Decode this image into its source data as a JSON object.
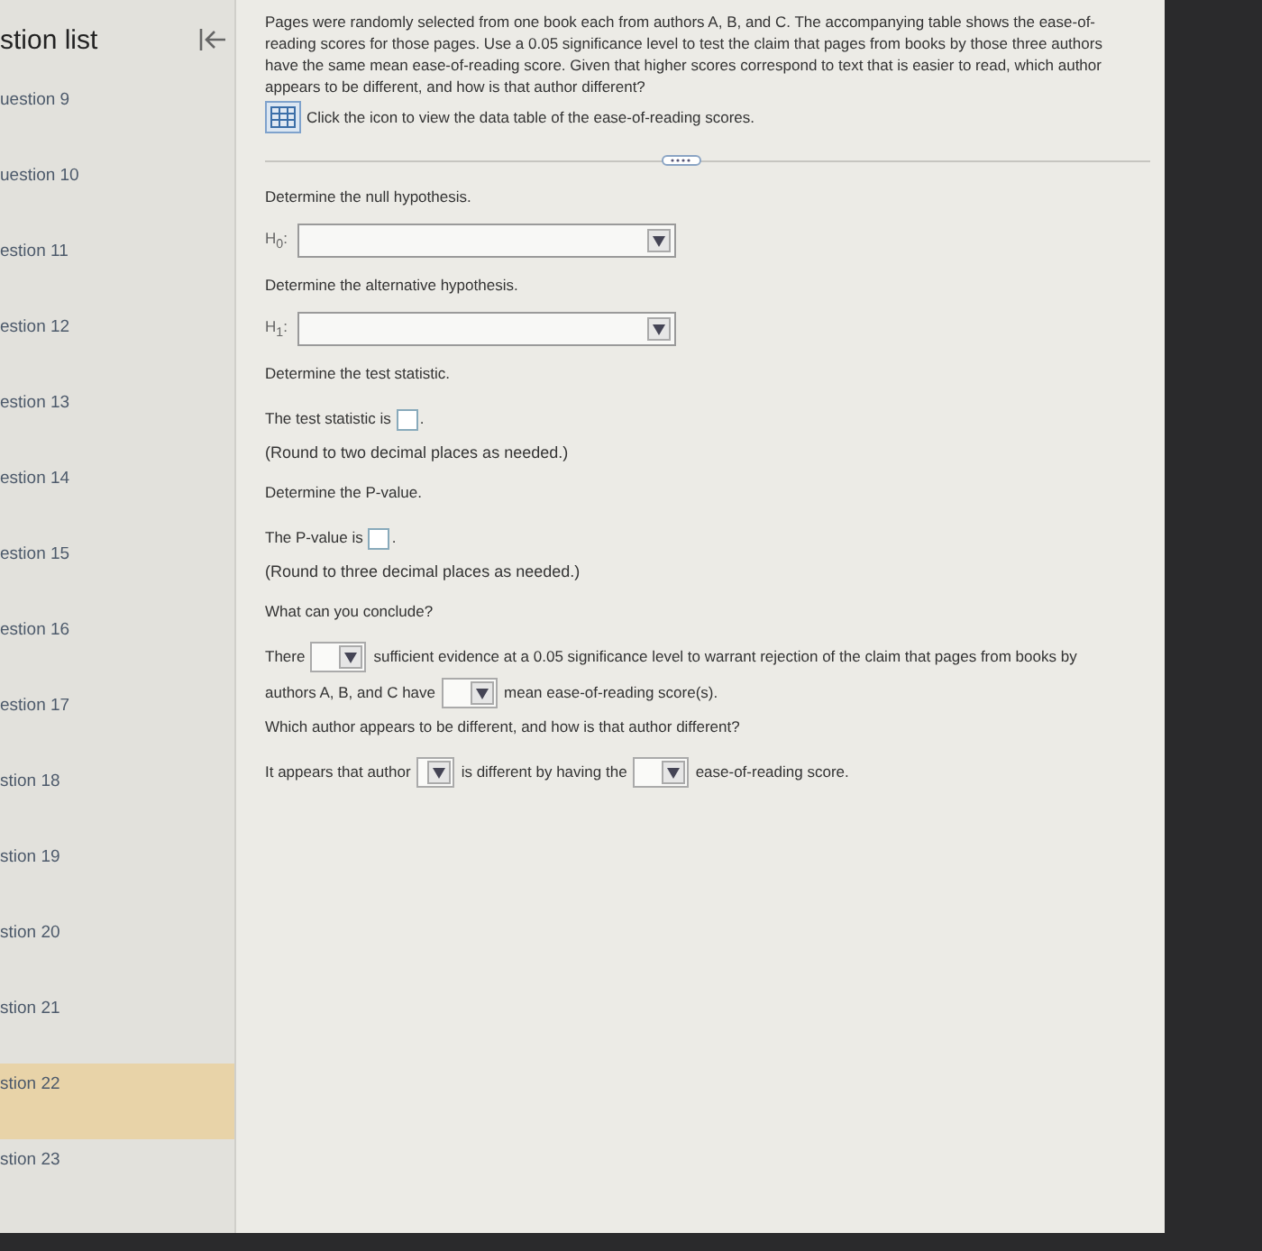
{
  "sidebar": {
    "title": "stion list",
    "items": [
      {
        "label": "uestion 9",
        "selected": false
      },
      {
        "label": "uestion 10",
        "selected": false
      },
      {
        "label": "estion 11",
        "selected": false
      },
      {
        "label": "estion 12",
        "selected": false
      },
      {
        "label": "estion 13",
        "selected": false
      },
      {
        "label": "estion 14",
        "selected": false
      },
      {
        "label": "estion 15",
        "selected": false
      },
      {
        "label": "estion 16",
        "selected": false
      },
      {
        "label": "estion 17",
        "selected": false
      },
      {
        "label": "stion 18",
        "selected": false
      },
      {
        "label": "stion 19",
        "selected": false
      },
      {
        "label": "stion 20",
        "selected": false
      },
      {
        "label": "stion 21",
        "selected": false
      },
      {
        "label": "stion 22",
        "selected": true
      },
      {
        "label": "stion 23",
        "selected": false
      }
    ]
  },
  "question": {
    "text": "Pages were randomly selected from one book each from authors A, B, and C. The accompanying table shows the ease-of-reading scores for those pages. Use a 0.05 significance level to test the claim that pages from books by those three authors have the same mean ease-of-reading score. Given that higher scores correspond to text that is easier to read, which author appears to be different, and how is that author different?",
    "table_link": "Click the icon to view the data table of the ease-of-reading scores."
  },
  "parts": [
    {
      "kind": "prompt",
      "text": "Determine the null hypothesis."
    },
    {
      "kind": "hypothesis",
      "label": "H$_{0}$:"
    },
    {
      "kind": "prompt",
      "text": "Determine the alternative hypothesis."
    },
    {
      "kind": "hypothesis",
      "label": "H$_{1}$:"
    },
    {
      "kind": "prompt",
      "text": "Determine the test statistic."
    },
    {
      "kind": "answer",
      "segments": [
        {
          "kind": "text",
          "text": "The test statistic is"
        },
        {
          "kind": "input"
        },
        {
          "kind": "text",
          "text": "."
        }
      ]
    },
    {
      "kind": "note",
      "text": "(Round to two decimal places as needed.)"
    },
    {
      "kind": "prompt",
      "text": "Determine the P-value."
    },
    {
      "kind": "answer",
      "segments": [
        {
          "kind": "text",
          "text": "The P-value is"
        },
        {
          "kind": "input"
        },
        {
          "kind": "text",
          "text": "."
        }
      ]
    },
    {
      "kind": "note",
      "text": "(Round to three decimal places as needed.)"
    },
    {
      "kind": "prompt",
      "text": "What can you conclude?"
    },
    {
      "kind": "answer",
      "segments": [
        {
          "kind": "text",
          "text": "There"
        },
        {
          "kind": "dropdown"
        },
        {
          "kind": "text",
          "text": "sufficient evidence at a 0.05 significance level to warrant rejection of the claim that pages from books by"
        },
        {
          "kind": "break"
        },
        {
          "kind": "text",
          "text": "authors A, B, and C have"
        },
        {
          "kind": "dropdown"
        },
        {
          "kind": "text",
          "text": "mean ease-of-reading score(s)."
        }
      ]
    },
    {
      "kind": "prompt",
      "text": "Which author appears to be different, and how is that author different?"
    },
    {
      "kind": "answer",
      "segments": [
        {
          "kind": "text",
          "text": "It appears that author"
        },
        {
          "kind": "smalldrop"
        },
        {
          "kind": "text",
          "text": "is different by having the"
        },
        {
          "kind": "dropdown"
        },
        {
          "kind": "text",
          "text": "ease-of-reading score."
        }
      ]
    }
  ]
}
